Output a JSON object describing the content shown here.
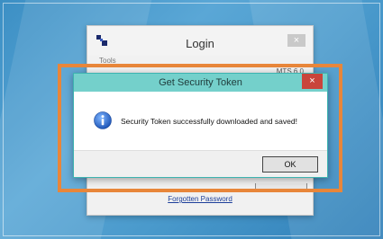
{
  "login_window": {
    "title": "Login",
    "close_glyph": "×",
    "menu_label": "Tools",
    "version_text": "MTS 6.0",
    "forgot_password_link": "Forgotten Password"
  },
  "dialog": {
    "title": "Get Security Token",
    "close_glyph": "×",
    "message": "Security Token successfully downloaded and saved!",
    "ok_label": "OK",
    "info_icon": "info-icon"
  },
  "colors": {
    "highlight": "#e8863a",
    "dialog_titlebar": "#74d0cb",
    "dialog_close": "#c9443b",
    "desktop": "#4a9acc"
  }
}
